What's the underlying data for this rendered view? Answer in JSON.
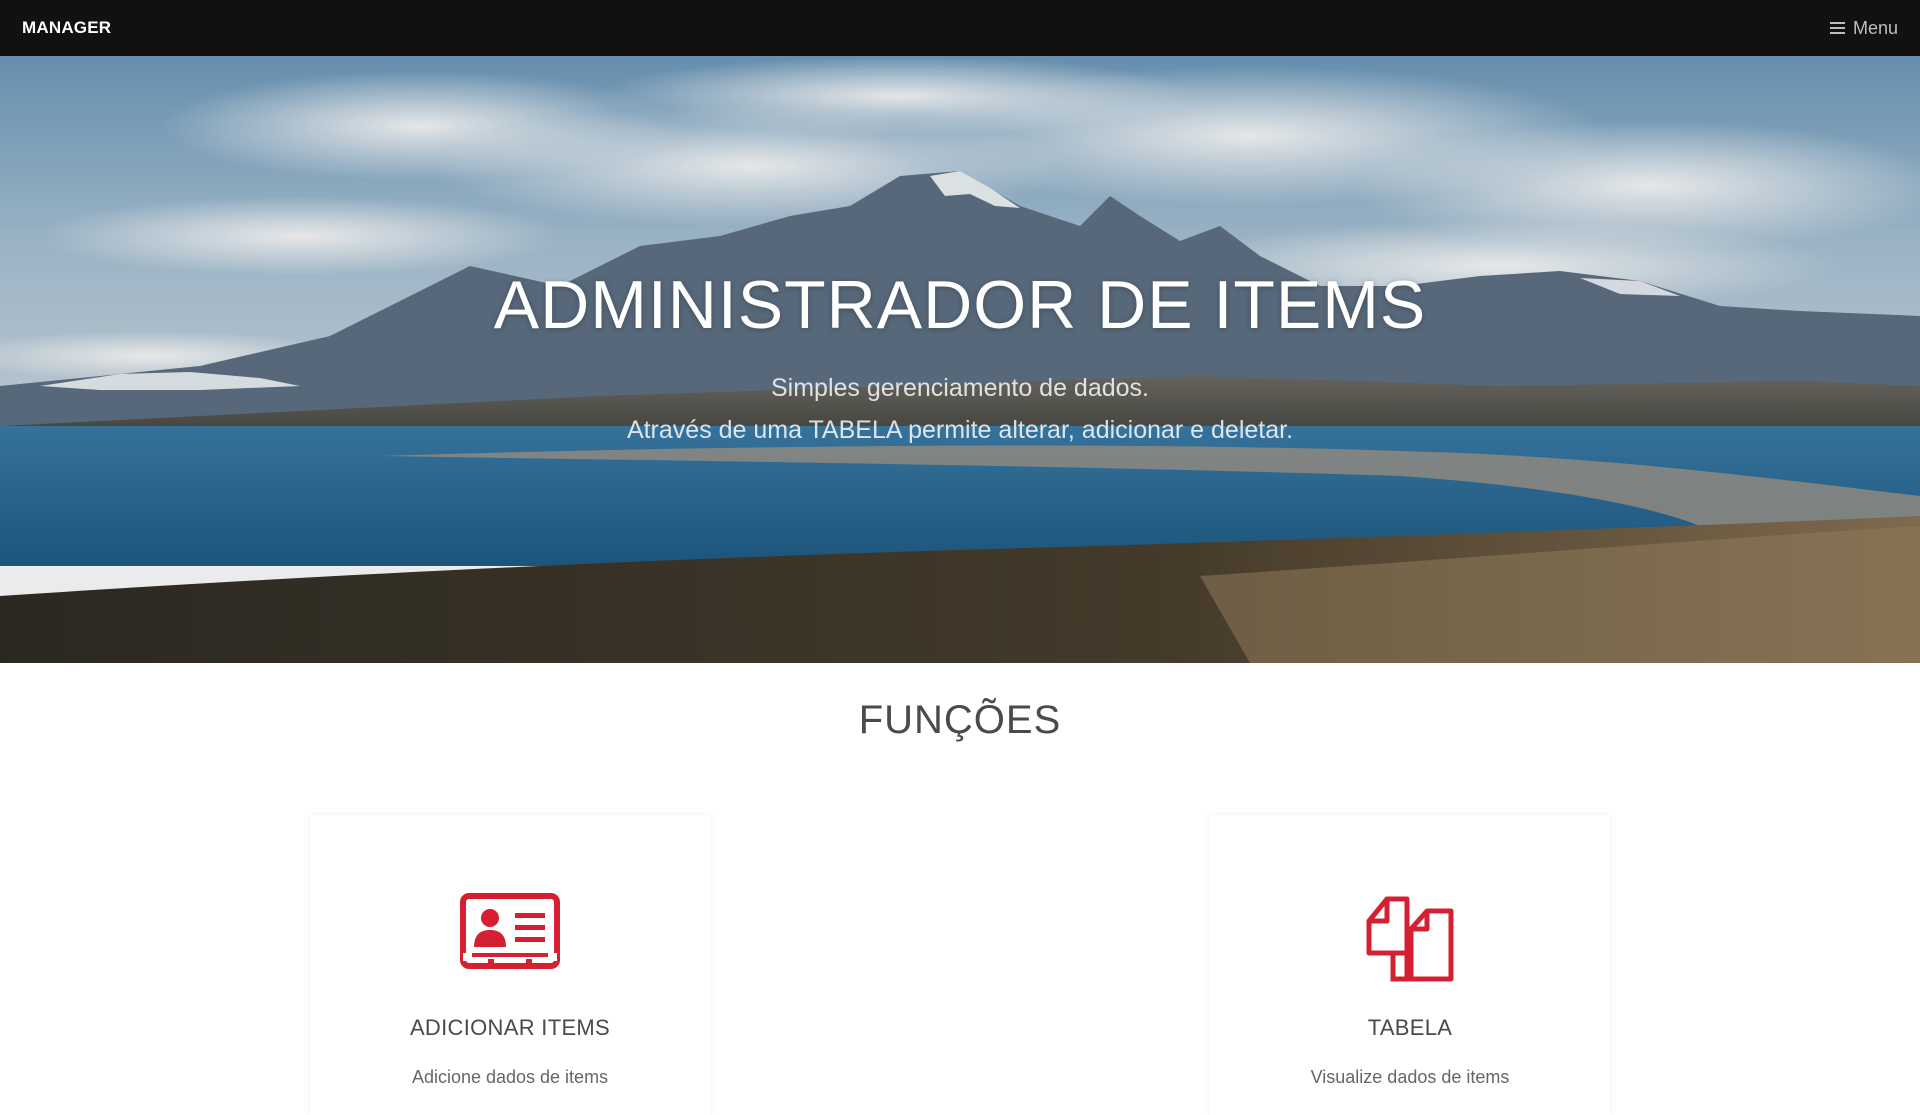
{
  "navbar": {
    "brand": "MANAGER",
    "menu_label": "Menu",
    "menu_icon": "bars-icon"
  },
  "hero": {
    "title": "ADMINISTRADOR DE ITEMS",
    "subtitle_line1": "Simples gerenciamento de dados.",
    "subtitle_line2": "Através de uma TABELA permite alterar, adicionar e deletar."
  },
  "functions": {
    "title": "FUNÇÕES",
    "cards": [
      {
        "icon": "id-card-icon",
        "title": "ADICIONAR ITEMS",
        "text": "Adicione dados de items"
      },
      {
        "icon": "documents-icon",
        "title": "TABELA",
        "text": "Visualize dados de items"
      }
    ]
  },
  "colors": {
    "navbar_bg": "#111111",
    "accent": "#d42030",
    "text_dark": "#4a4a4a"
  }
}
